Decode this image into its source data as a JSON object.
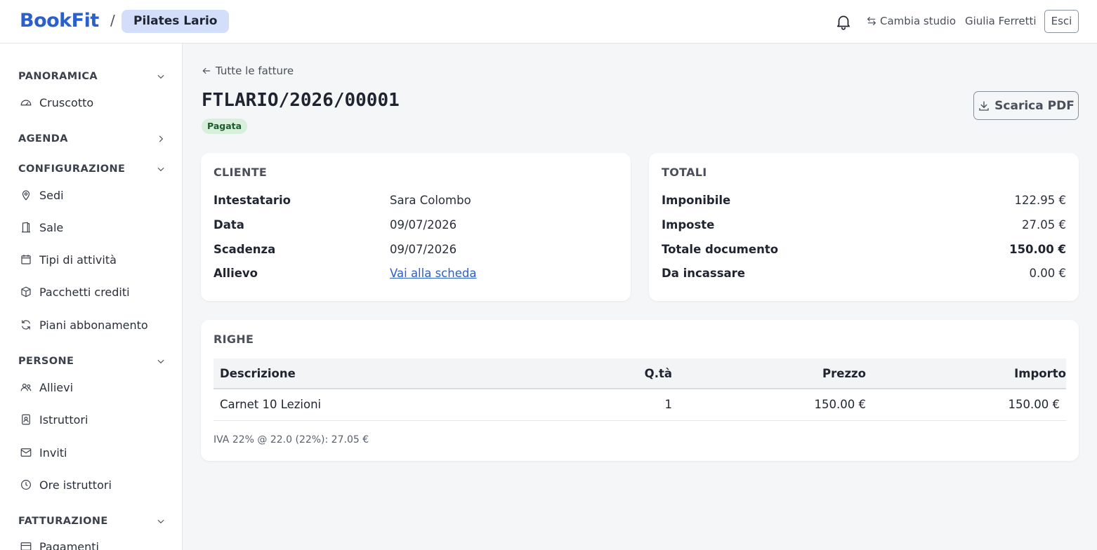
{
  "header": {
    "logo": "BookFit",
    "separator": "/",
    "studio": "Pilates Lario",
    "switch_label": "Cambia studio",
    "user": "Giulia Ferretti",
    "logout": "Esci"
  },
  "sidebar": {
    "sections": [
      {
        "title": "PANORAMICA",
        "items": [
          {
            "label": "Cruscotto",
            "icon": "gauge-icon"
          }
        ]
      },
      {
        "title": "AGENDA",
        "items": []
      },
      {
        "title": "CONFIGURAZIONE",
        "items": [
          {
            "label": "Sedi",
            "icon": "map-pin-icon"
          },
          {
            "label": "Sale",
            "icon": "door-icon"
          },
          {
            "label": "Tipi di attività",
            "icon": "calendar-icon"
          },
          {
            "label": "Pacchetti crediti",
            "icon": "package-icon"
          },
          {
            "label": "Piani abbonamento",
            "icon": "refresh-icon"
          }
        ]
      },
      {
        "title": "PERSONE",
        "items": [
          {
            "label": "Allievi",
            "icon": "users-icon"
          },
          {
            "label": "Istruttori",
            "icon": "badge-icon"
          },
          {
            "label": "Inviti",
            "icon": "mail-icon"
          },
          {
            "label": "Ore istruttori",
            "icon": "clock-icon"
          }
        ]
      },
      {
        "title": "FATTURAZIONE",
        "items": [
          {
            "label": "Pagamenti",
            "icon": "card-icon"
          }
        ]
      }
    ]
  },
  "main": {
    "back_label": "Tutte le fatture",
    "invoice_number": "FTLARIO/2026/00001",
    "status": "Pagata",
    "download_label": "Scarica PDF",
    "client": {
      "heading": "CLIENTE",
      "rows": [
        {
          "label": "Intestatario",
          "value": "Sara Colombo"
        },
        {
          "label": "Data",
          "value": "09/07/2026"
        },
        {
          "label": "Scadenza",
          "value": "09/07/2026"
        },
        {
          "label": "Allievo",
          "value": "Vai alla scheda"
        }
      ]
    },
    "totals": {
      "heading": "TOTALI",
      "rows": [
        {
          "label": "Imponibile",
          "value": "122.95 €"
        },
        {
          "label": "Imposte",
          "value": "27.05 €"
        },
        {
          "label": "Totale documento",
          "value": "150.00 €"
        },
        {
          "label": "Da incassare",
          "value": "0.00 €"
        }
      ]
    },
    "lines": {
      "heading": "RIGHE",
      "columns": {
        "desc": "Descrizione",
        "qty": "Q.tà",
        "price": "Prezzo",
        "amount": "Importo"
      },
      "rows": [
        {
          "desc": "Carnet 10 Lezioni",
          "qty": "1",
          "price": "150.00 €",
          "amount": "150.00 €"
        }
      ],
      "tax_note": "IVA 22% @ 22.0 (22%): 27.05 €"
    }
  },
  "colors": {
    "accent": "#2b5fc9",
    "pill": "#d3defa",
    "paid_badge_bg": "#d6f0dc",
    "paid_badge_text": "#1e5a2c"
  }
}
